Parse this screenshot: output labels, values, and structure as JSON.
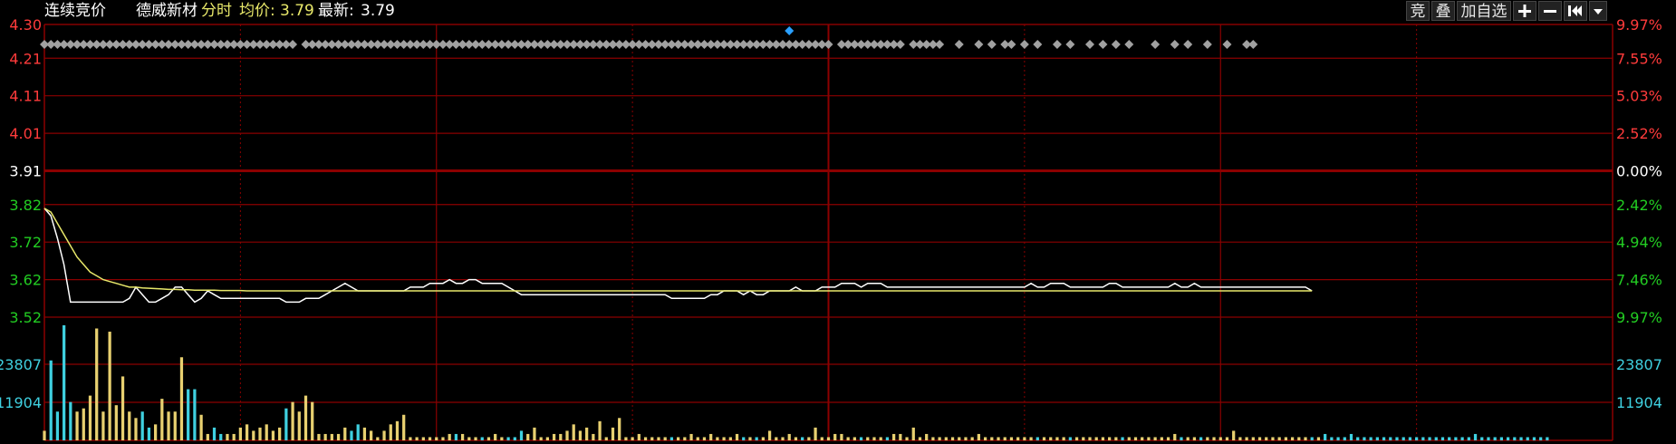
{
  "header": {
    "mode": "连续竞价",
    "stock_name": "德威新材",
    "view": "分时",
    "avg_label": "均价:",
    "avg_value": "3.79",
    "latest_label": "最新:",
    "latest_value": "3.79"
  },
  "toolbar": {
    "jing_label": "竞",
    "die_label": "叠",
    "add_watch_label": "加自选",
    "plus_icon": "plus-icon",
    "minus_icon": "minus-icon",
    "first_icon": "skip-to-start-icon",
    "dropdown_icon": "chevron-down-icon"
  },
  "colors": {
    "up": "#ff3b3b",
    "down": "#22cc22",
    "neutral": "#ffffff",
    "grid": "#8b0000",
    "price_line": "#ffffff",
    "avg_line": "#e8e86a",
    "volume_cyan": "#3fd0e0",
    "volume_yellow": "#e8d070",
    "diamond": "#a0a0a0",
    "diamond_highlight": "#2aa0ff"
  },
  "chart_data": {
    "type": "line",
    "prev_close": 3.91,
    "price_axis": {
      "ylim": [
        3.52,
        4.3
      ],
      "ticks": [
        "4.30",
        "4.21",
        "4.11",
        "4.01",
        "3.91",
        "3.82",
        "3.72",
        "3.62",
        "3.52"
      ],
      "tick_values": [
        4.3,
        4.21,
        4.11,
        4.01,
        3.91,
        3.82,
        3.72,
        3.62,
        3.52
      ]
    },
    "pct_axis": {
      "ticks": [
        "9.97%",
        "7.55%",
        "5.03%",
        "2.52%",
        "0.00%",
        "2.42%",
        "4.94%",
        "7.46%",
        "9.97%"
      ]
    },
    "volume_axis": {
      "ticks": [
        "23807",
        "11904"
      ],
      "tick_values": [
        23807,
        11904
      ],
      "max": 35710
    },
    "x_range": [
      0,
      240
    ],
    "series": [
      {
        "values": [
          3.81,
          3.79,
          3.73,
          3.66,
          3.56,
          3.56,
          3.56,
          3.56,
          3.56,
          3.56,
          3.56,
          3.56,
          3.56,
          3.57,
          3.6,
          3.58,
          3.56,
          3.56,
          3.57,
          3.58,
          3.6,
          3.6,
          3.58,
          3.56,
          3.57,
          3.59,
          3.58,
          3.57,
          3.57,
          3.57,
          3.57,
          3.57,
          3.57,
          3.57,
          3.57,
          3.57,
          3.57,
          3.56,
          3.56,
          3.56,
          3.57,
          3.57,
          3.57,
          3.58,
          3.59,
          3.6,
          3.61,
          3.6,
          3.59,
          3.59,
          3.59,
          3.59,
          3.59,
          3.59,
          3.59,
          3.59,
          3.6,
          3.6,
          3.6,
          3.61,
          3.61,
          3.61,
          3.62,
          3.61,
          3.61,
          3.62,
          3.62,
          3.61,
          3.61,
          3.61,
          3.61,
          3.6,
          3.59,
          3.58,
          3.58,
          3.58,
          3.58,
          3.58,
          3.58,
          3.58,
          3.58,
          3.58,
          3.58,
          3.58,
          3.58,
          3.58,
          3.58,
          3.58,
          3.58,
          3.58,
          3.58,
          3.58,
          3.58,
          3.58,
          3.58,
          3.58,
          3.57,
          3.57,
          3.57,
          3.57,
          3.57,
          3.57,
          3.58,
          3.58,
          3.59,
          3.59,
          3.59,
          3.58,
          3.59,
          3.58,
          3.58,
          3.59,
          3.59,
          3.59,
          3.59,
          3.6,
          3.59,
          3.59,
          3.59,
          3.6,
          3.6,
          3.6,
          3.61,
          3.61,
          3.61,
          3.6,
          3.61,
          3.61,
          3.61,
          3.6,
          3.6,
          3.6,
          3.6,
          3.6,
          3.6,
          3.6,
          3.6,
          3.6,
          3.6,
          3.6,
          3.6,
          3.6,
          3.6,
          3.6,
          3.6,
          3.6,
          3.6,
          3.6,
          3.6,
          3.6,
          3.6,
          3.61,
          3.6,
          3.6,
          3.61,
          3.61,
          3.61,
          3.6,
          3.6,
          3.6,
          3.6,
          3.6,
          3.6,
          3.61,
          3.61,
          3.6,
          3.6,
          3.6,
          3.6,
          3.6,
          3.6,
          3.6,
          3.6,
          3.61,
          3.6,
          3.6,
          3.61,
          3.6,
          3.6,
          3.6,
          3.6,
          3.6,
          3.6,
          3.6,
          3.6,
          3.6,
          3.6,
          3.6,
          3.6,
          3.6,
          3.6,
          3.6,
          3.6,
          3.6,
          3.59
        ],
        "color_ref": "price_line"
      },
      {
        "values": [
          3.81,
          3.8,
          3.77,
          3.74,
          3.71,
          3.68,
          3.66,
          3.64,
          3.63,
          3.62,
          3.615,
          3.61,
          3.605,
          3.6,
          3.6,
          3.598,
          3.597,
          3.596,
          3.595,
          3.594,
          3.594,
          3.593,
          3.593,
          3.592,
          3.592,
          3.592,
          3.592,
          3.591,
          3.591,
          3.591,
          3.591,
          3.59,
          3.59,
          3.59,
          3.59,
          3.59,
          3.59,
          3.59,
          3.59,
          3.59,
          3.59,
          3.59,
          3.59,
          3.59,
          3.59,
          3.59,
          3.59,
          3.59,
          3.59,
          3.59,
          3.59,
          3.59,
          3.59,
          3.59,
          3.59,
          3.59,
          3.59,
          3.59,
          3.59,
          3.59,
          3.59,
          3.59,
          3.59,
          3.59,
          3.59,
          3.59,
          3.59,
          3.59,
          3.59,
          3.59,
          3.59,
          3.59,
          3.59,
          3.59,
          3.59,
          3.59,
          3.59,
          3.59,
          3.59,
          3.59,
          3.59,
          3.59,
          3.59,
          3.59,
          3.59,
          3.59,
          3.59,
          3.59,
          3.59,
          3.59,
          3.59,
          3.59,
          3.59,
          3.59,
          3.59,
          3.59,
          3.59,
          3.59,
          3.59,
          3.59,
          3.59,
          3.59,
          3.59,
          3.59,
          3.59,
          3.59,
          3.59,
          3.59,
          3.59,
          3.59,
          3.59,
          3.59,
          3.59,
          3.59,
          3.59,
          3.59,
          3.59,
          3.59,
          3.59,
          3.59,
          3.59,
          3.59,
          3.59,
          3.59,
          3.59,
          3.59,
          3.59,
          3.59,
          3.59,
          3.59,
          3.59,
          3.59,
          3.59,
          3.59,
          3.59,
          3.59,
          3.59,
          3.59,
          3.59,
          3.59,
          3.59,
          3.59,
          3.59,
          3.59,
          3.59,
          3.59,
          3.59,
          3.59,
          3.59,
          3.59,
          3.59,
          3.59,
          3.59,
          3.59,
          3.59,
          3.59,
          3.59,
          3.59,
          3.59,
          3.59,
          3.59,
          3.59,
          3.59,
          3.59,
          3.59,
          3.59,
          3.59,
          3.59,
          3.59,
          3.59,
          3.59,
          3.59,
          3.59,
          3.59,
          3.59,
          3.59,
          3.59,
          3.59,
          3.59,
          3.59,
          3.59,
          3.59,
          3.59,
          3.59,
          3.59,
          3.59,
          3.59,
          3.59,
          3.59,
          3.59,
          3.59,
          3.59,
          3.59,
          3.59,
          3.59
        ],
        "color_ref": "avg_line"
      }
    ],
    "volume": [
      3000,
      25000,
      9000,
      36000,
      12000,
      9000,
      10000,
      14000,
      35000,
      9000,
      34000,
      11000,
      20000,
      9000,
      7000,
      9000,
      4000,
      5000,
      13000,
      9000,
      9000,
      26000,
      16000,
      16000,
      8000,
      2000,
      4000,
      2000,
      2000,
      2000,
      4000,
      5000,
      3000,
      4000,
      5000,
      3000,
      4000,
      10000,
      12000,
      9000,
      14000,
      12000,
      2000,
      2000,
      2000,
      2000,
      4000,
      3000,
      5000,
      4000,
      3000,
      1000,
      3000,
      5000,
      6000,
      8000,
      1000,
      1000,
      1000,
      1000,
      1000,
      1000,
      2000,
      2000,
      2000,
      1000,
      1000,
      1000,
      1000,
      2000,
      1000,
      1000,
      1000,
      3000,
      2000,
      4000,
      1000,
      1000,
      2000,
      2000,
      3000,
      5000,
      3000,
      4000,
      2000,
      6000,
      1000,
      4000,
      7000,
      1000,
      1000,
      2000,
      1000,
      1000,
      1000,
      1000,
      1000,
      1000,
      1000,
      2000,
      1000,
      1000,
      2000,
      1000,
      1000,
      1000,
      2000,
      1000,
      1000,
      1000,
      1000,
      3000,
      1000,
      1000,
      2000,
      1000,
      1000,
      1000,
      4000,
      1000,
      1000,
      2000,
      2000,
      1000,
      1000,
      1000,
      1000,
      1000,
      1000,
      1000,
      2000,
      2000,
      1000,
      4000,
      1000,
      2000,
      1000,
      1000,
      1000,
      1000,
      1000,
      1000,
      1000,
      2000,
      1000,
      1000,
      1000,
      1000,
      1000,
      1000,
      1000,
      1000,
      1000,
      1000,
      1000,
      1000,
      1000,
      1000,
      1000,
      1000,
      1000,
      1000,
      1000,
      1000,
      1000,
      1000,
      1000,
      1000,
      1000,
      1000,
      1000,
      1000,
      1000,
      2000,
      1000,
      1000,
      1000,
      1000,
      1000,
      1000,
      1000,
      1000,
      3000,
      1000,
      1000,
      1000,
      1000,
      1000,
      1000,
      1000,
      1000,
      1000,
      1000,
      1000,
      1000,
      1000,
      2000,
      1000,
      1000,
      1000,
      2000,
      1000,
      1000,
      1000,
      1000,
      1000,
      1000,
      1000,
      1000,
      1000,
      1000,
      1000,
      1000,
      1000,
      1000,
      1000,
      1000,
      1000,
      1000,
      2000,
      1000,
      1000,
      1000,
      1000,
      1000,
      1000,
      1000,
      1000,
      1000,
      1000,
      1000
    ],
    "trade_markers_x": [
      0,
      1,
      2,
      3,
      4,
      5,
      6,
      7,
      8,
      9,
      10,
      11,
      12,
      13,
      14,
      15,
      16,
      17,
      18,
      19,
      20,
      21,
      22,
      23,
      24,
      25,
      26,
      27,
      28,
      29,
      30,
      31,
      32,
      33,
      34,
      35,
      36,
      37,
      38,
      40,
      41,
      42,
      43,
      44,
      45,
      46,
      47,
      48,
      49,
      50,
      51,
      52,
      53,
      54,
      55,
      56,
      57,
      58,
      59,
      60,
      61,
      62,
      63,
      64,
      65,
      66,
      67,
      68,
      69,
      70,
      71,
      72,
      73,
      74,
      75,
      76,
      77,
      78,
      79,
      80,
      81,
      82,
      83,
      84,
      85,
      86,
      87,
      88,
      89,
      90,
      91,
      92,
      93,
      94,
      95,
      96,
      97,
      98,
      99,
      100,
      101,
      102,
      103,
      104,
      105,
      106,
      107,
      108,
      109,
      110,
      111,
      112,
      113,
      114,
      115,
      116,
      117,
      118,
      119,
      120,
      122,
      123,
      124,
      125,
      126,
      127,
      128,
      129,
      130,
      131,
      133,
      134,
      135,
      136,
      137,
      140,
      143,
      145,
      147,
      148,
      150,
      152,
      155,
      157,
      160,
      162,
      164,
      166,
      170,
      173,
      175,
      178,
      181,
      184,
      185
    ],
    "trade_marker_highlight_x": 114
  }
}
